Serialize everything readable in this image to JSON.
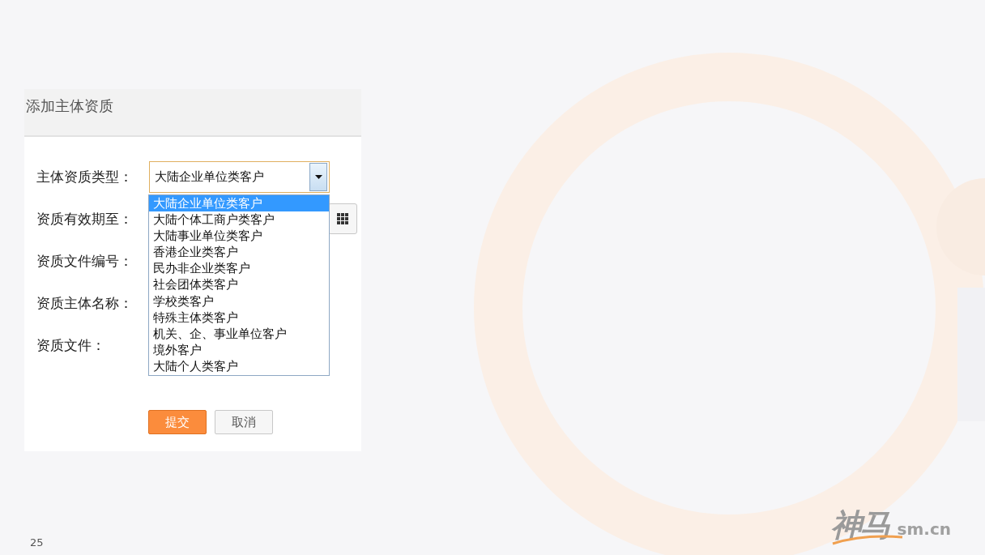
{
  "panel": {
    "title": "添加主体资质"
  },
  "fields": [
    {
      "label": "主体资质类型：",
      "kind": "select",
      "value": "大陆企业单位类客户"
    },
    {
      "label": "资质有效期至：",
      "kind": "date"
    },
    {
      "label": "资质文件编号：",
      "kind": "text"
    },
    {
      "label": "资质主体名称：",
      "kind": "text"
    },
    {
      "label": "资质文件：",
      "kind": "file"
    }
  ],
  "dropdown": {
    "options": [
      {
        "label": "大陆企业单位类客户",
        "selected": true
      },
      {
        "label": "大陆个体工商户类客户",
        "selected": false
      },
      {
        "label": "大陆事业单位类客户",
        "selected": false
      },
      {
        "label": "香港企业类客户",
        "selected": false
      },
      {
        "label": "民办非企业类客户",
        "selected": false
      },
      {
        "label": "社会团体类客户",
        "selected": false
      },
      {
        "label": "学校类客户",
        "selected": false
      },
      {
        "label": "特殊主体类客户",
        "selected": false
      },
      {
        "label": "机关、企、事业单位客户",
        "selected": false
      },
      {
        "label": "境外客户",
        "selected": false
      },
      {
        "label": "大陆个人类客户",
        "selected": false
      }
    ]
  },
  "buttons": [
    {
      "label": "提交",
      "kind": "primary"
    },
    {
      "label": "取消",
      "kind": "secondary"
    }
  ],
  "slide": {
    "page_number": "25",
    "logo": {
      "name": "神马",
      "domain": "sm.cn"
    }
  }
}
